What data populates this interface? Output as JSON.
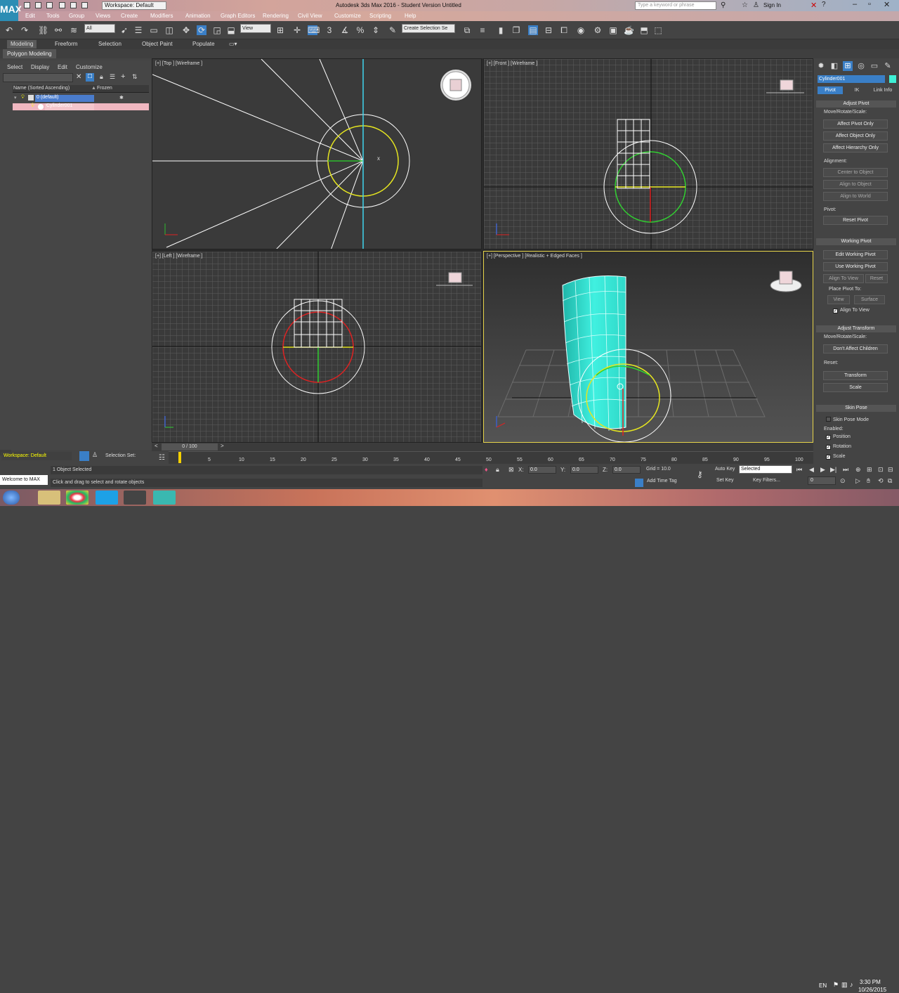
{
  "titlebar": {
    "title": "Autodesk 3ds Max 2016 - Student Version    Untitled",
    "app_button": "MAX",
    "workspace": "Workspace: Default",
    "search_placeholder": "Type a keyword or phrase",
    "sign_in": "Sign In"
  },
  "menubar": {
    "items": [
      "Edit",
      "Tools",
      "Group",
      "Views",
      "Create",
      "Modifiers",
      "Animation",
      "Graph Editors",
      "Rendering",
      "Civil View",
      "Customize",
      "Scripting",
      "Help"
    ]
  },
  "toolbar": {
    "selection_filter": "All",
    "ref_coord": "View",
    "named_sel": "Create Selection Se"
  },
  "ribbon": {
    "tabs": [
      "Modeling",
      "Freeform",
      "Selection",
      "Object Paint",
      "Populate"
    ],
    "polygon_modeling": "Polygon Modeling"
  },
  "scene_explorer": {
    "menu": [
      "Select",
      "Display",
      "Edit",
      "Customize"
    ],
    "col_name": "Name (Sorted Ascending)",
    "col_frozen": "Frozen",
    "rows": [
      "0 (default)",
      "Cylinder001"
    ]
  },
  "viewports": {
    "top": "[+] [Top ] [Wireframe ]",
    "front": "[+] [Front ] [Wireframe ]",
    "left": "[+] [Left ] [Wireframe ]",
    "perspective": "[+] [Perspective ] [Realistic + Edged Faces ]"
  },
  "command_panel": {
    "object_name": "Cylinder001",
    "subtabs": [
      "Pivot",
      "IK",
      "Link Info"
    ],
    "adjust_pivot": {
      "title": "Adjust Pivot",
      "move_label": "Move/Rotate/Scale:",
      "btn1": "Affect Pivot Only",
      "btn2": "Affect Object Only",
      "btn3": "Affect Hierarchy Only",
      "alignment": "Alignment:",
      "center": "Center to Object",
      "align_obj": "Align to Object",
      "align_world": "Align to World",
      "pivot_label": "Pivot:",
      "reset_pivot": "Reset Pivot"
    },
    "working_pivot": {
      "title": "Working Pivot",
      "edit": "Edit Working Pivot",
      "use": "Use Working Pivot",
      "align_view": "Align To View",
      "reset": "Reset",
      "place_to": "Place Pivot To:",
      "view": "View",
      "surface": "Surface",
      "align_to_view_check": "Align To View"
    },
    "adjust_transform": {
      "title": "Adjust Transform",
      "move_label": "Move/Rotate/Scale:",
      "dont_affect": "Don't Affect Children",
      "reset_label": "Reset:",
      "transform": "Transform",
      "scale": "Scale"
    },
    "skin_pose": {
      "title": "Skin Pose",
      "mode": "Skin Pose Mode",
      "enabled": "Enabled:",
      "position": "Position",
      "rotation": "Rotation",
      "scale": "Scale"
    }
  },
  "timeline": {
    "slider": "0 / 100",
    "ticks": [
      "0",
      "5",
      "10",
      "15",
      "20",
      "25",
      "30",
      "35",
      "40",
      "45",
      "50",
      "55",
      "60",
      "65",
      "70",
      "75",
      "80",
      "85",
      "90",
      "95",
      "100"
    ]
  },
  "status": {
    "workspace": "Workspace: Default",
    "selection_set": "Selection Set:",
    "welcome": "Welcome to MAX",
    "line1": "1 Object Selected",
    "line2": "Click and drag to select and rotate objects",
    "x_label": "X:",
    "y_label": "Y:",
    "z_label": "Z:",
    "x_val": "0.0",
    "y_val": "0.0",
    "z_val": "0.0",
    "grid": "Grid = 10.0",
    "add_time_tag": "Add Time Tag",
    "auto_key": "Auto Key",
    "set_key": "Set Key",
    "selected_dd": "Selected",
    "key_filters": "Key Filters...",
    "frame": "0"
  },
  "taskbar": {
    "lang": "EN",
    "time": "3:30 PM",
    "date": "10/26/2015"
  }
}
